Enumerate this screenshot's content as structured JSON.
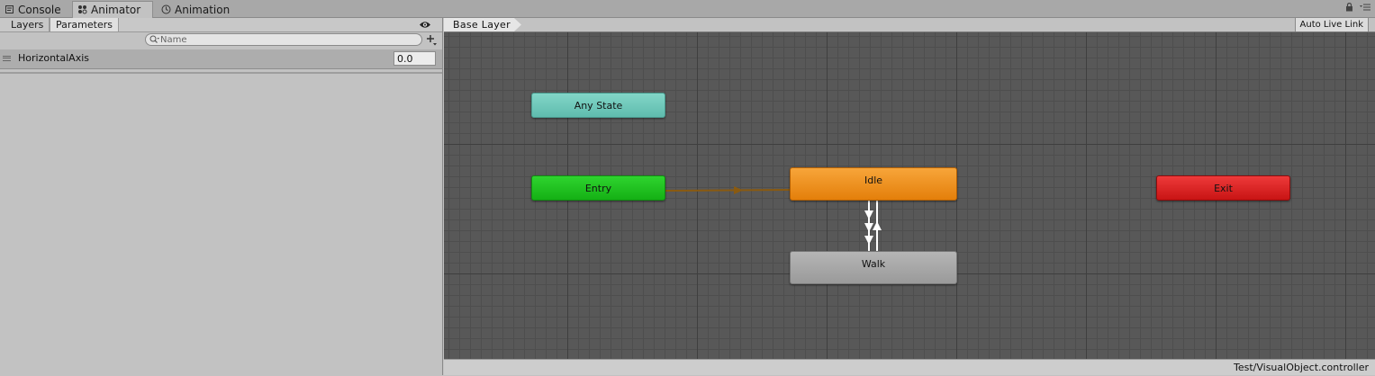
{
  "window_tabs": [
    {
      "label": "Console",
      "icon": "console-icon"
    },
    {
      "label": "Animator",
      "icon": "animator-icon",
      "active": true
    },
    {
      "label": "Animation",
      "icon": "clock-icon"
    }
  ],
  "window_controls": {
    "lock_icon": "lock-icon",
    "menu_icon": "menu-icon"
  },
  "left_panel": {
    "tabs": [
      "Layers",
      "Parameters"
    ],
    "active_tab": "Parameters",
    "search": {
      "placeholder": "Name",
      "value": ""
    },
    "add_icon": "plus-icon",
    "visibility_icon": "eye-icon",
    "parameters": [
      {
        "name": "HorizontalAxis",
        "value": "0.0"
      }
    ]
  },
  "graph": {
    "breadcrumb": "Base Layer",
    "live_link_label": "Auto Live Link",
    "states": {
      "any_state": "Any State",
      "entry": "Entry",
      "idle": "Idle",
      "walk": "Walk",
      "exit": "Exit"
    },
    "colors": {
      "any_state": "#6fc9bb",
      "entry": "#1fc21f",
      "idle": "#ee9220",
      "walk": "#a8a8a8",
      "exit": "#dc2424",
      "default_transition": "#8a5a10",
      "transition": "#ffffff"
    },
    "transitions": [
      {
        "from": "Entry",
        "to": "Idle",
        "default": true
      },
      {
        "from": "Idle",
        "to": "Walk"
      },
      {
        "from": "Walk",
        "to": "Idle"
      }
    ]
  },
  "status": {
    "asset_path": "Test/VisualObject.controller"
  }
}
